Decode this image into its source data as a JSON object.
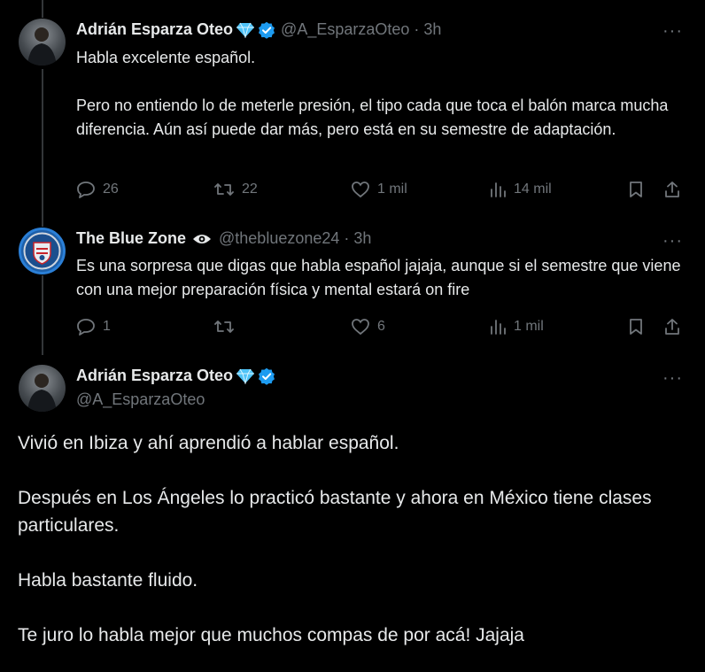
{
  "tweets": [
    {
      "author": "Adrián Esparza Oteo",
      "handle": "@A_EsparzaOteo",
      "time": "3h",
      "paragraphs": [
        "Habla excelente español.",
        "Pero no entiendo lo de meterle presión, el tipo cada que toca el balón marca mucha diferencia. Aún así puede dar más, pero está en su semestre de adaptación."
      ],
      "replies": "26",
      "reposts": "22",
      "likes": "1 mil",
      "views": "14 mil"
    },
    {
      "author": "The Blue Zone",
      "handle": "@thebluezone24",
      "time": "3h",
      "paragraphs": [
        "Es una sorpresa que digas que habla español jajaja, aunque si el semestre que viene con una mejor preparación física y mental estará on fire"
      ],
      "replies": "1",
      "reposts": "",
      "likes": "6",
      "views": "1 mil"
    }
  ],
  "main_tweet": {
    "author": "Adrián Esparza Oteo",
    "handle": "@A_EsparzaOteo",
    "paragraphs": [
      "Vivió en Ibiza y ahí aprendió a hablar español.",
      "Después en Los Ángeles lo practicó bastante y ahora en México tiene clases particulares.",
      "Habla bastante fluido.",
      "Te juro lo habla mejor que muchos compas de por acá! Jajaja"
    ]
  },
  "ui": {
    "more": "···",
    "separator": "·"
  },
  "colors": {
    "background": "#000000",
    "text": "#e7e9ea",
    "muted": "#71767b",
    "verified": "#1d9bf0",
    "diamond": "#4fc3f7"
  }
}
